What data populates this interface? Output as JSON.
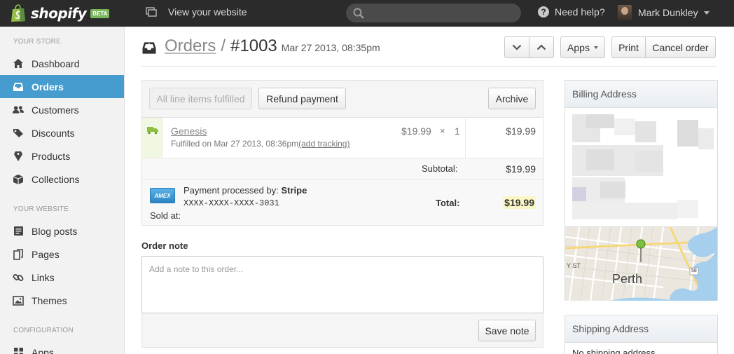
{
  "topbar": {
    "brand": "shopify",
    "beta_badge": "BETA",
    "view_site": "View your website",
    "search_placeholder": "",
    "help": "Need help?",
    "user_name": "Mark Dunkley"
  },
  "sidebar": {
    "sections": [
      {
        "heading": "YOUR STORE"
      },
      {
        "heading": "YOUR WEBSITE"
      },
      {
        "heading": "CONFIGURATION"
      }
    ],
    "items": [
      {
        "label": "Dashboard",
        "icon": "home-icon",
        "active": false
      },
      {
        "label": "Orders",
        "icon": "inbox-icon",
        "active": true
      },
      {
        "label": "Customers",
        "icon": "users-icon",
        "active": false
      },
      {
        "label": "Discounts",
        "icon": "tag-icon",
        "active": false
      },
      {
        "label": "Products",
        "icon": "price-tag-icon",
        "active": false
      },
      {
        "label": "Collections",
        "icon": "box-icon",
        "active": false
      },
      {
        "label": "Blog posts",
        "icon": "blog-icon",
        "active": false
      },
      {
        "label": "Pages",
        "icon": "pages-icon",
        "active": false
      },
      {
        "label": "Links",
        "icon": "link-icon",
        "active": false
      },
      {
        "label": "Themes",
        "icon": "image-icon",
        "active": false
      },
      {
        "label": "Apps",
        "icon": "apps-icon",
        "active": false
      }
    ]
  },
  "header": {
    "breadcrumb": "Orders",
    "separator": "/",
    "order_number": "#1003",
    "order_date": "Mar 27 2013, 08:35pm",
    "apps_label": "Apps",
    "print_label": "Print",
    "cancel_label": "Cancel order"
  },
  "order": {
    "all_fulfilled_label": "All line items fulfilled",
    "refund_label": "Refund payment",
    "archive_label": "Archive",
    "line_items": [
      {
        "name": "Genesis",
        "fulfilled_text": "Fulfilled on Mar 27 2013, 08:36pm",
        "tracking_link": "(add tracking)",
        "price": "$19.99",
        "times": "×",
        "quantity": "1",
        "total": "$19.99"
      }
    ],
    "subtotal_label": "Subtotal:",
    "subtotal": "$19.99",
    "payment_prefix": "Payment processed by:",
    "payment_gateway": "Stripe",
    "card_brand": "AMEX",
    "card_number": "XXXX-XXXX-XXXX-3031",
    "sold_at_label": "Sold at:",
    "total_label": "Total:",
    "total": "$19.99"
  },
  "note": {
    "label": "Order note",
    "placeholder": "Add a note to this order...",
    "save_label": "Save note"
  },
  "billing": {
    "title": "Billing Address",
    "map_city": "Perth",
    "map_street": "Y ST",
    "map_route": "58"
  },
  "shipping": {
    "title": "Shipping Address",
    "partial_text": "No shipping address"
  },
  "colors": {
    "topbar": "#2b2b2b",
    "sidebar_active": "#479ccf",
    "brand_green": "#7ab55c",
    "total_highlight": "#fbf7c5"
  }
}
